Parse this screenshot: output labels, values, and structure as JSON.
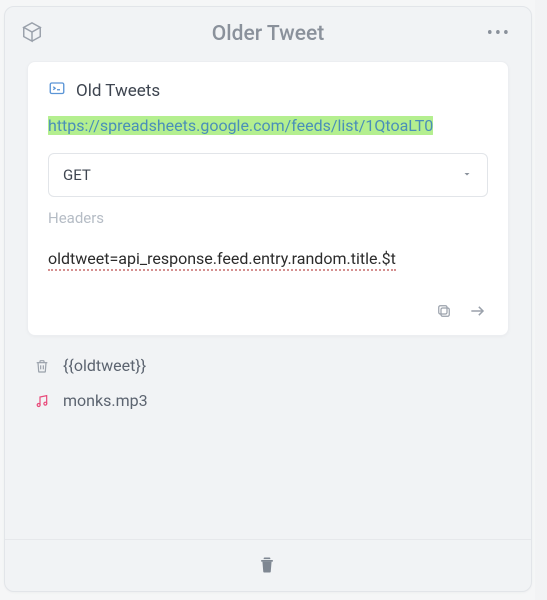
{
  "header": {
    "title": "Older Tweet"
  },
  "card": {
    "title": "Old Tweets",
    "url": "https://spreadsheets.google.com/feeds/list/1QtoaLT0",
    "method": "GET",
    "headers_placeholder": "Headers",
    "expression": "oldtweet=api_response.feed.entry.random.title.$t"
  },
  "items": [
    {
      "kind": "text",
      "label": "{{oldtweet}}"
    },
    {
      "kind": "audio",
      "label": "monks.mp3"
    }
  ]
}
